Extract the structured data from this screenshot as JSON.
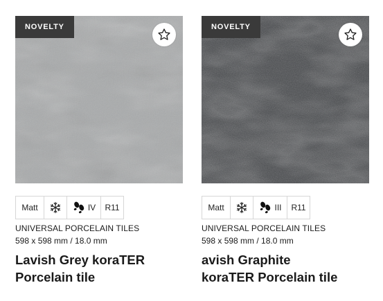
{
  "products": [
    {
      "badge": "NOVELTY",
      "attributes": {
        "finish": "Matt",
        "frost_icon": "snowflake-icon",
        "wear_icon": "footprints-icon",
        "wear": "IV",
        "slip": "R11"
      },
      "category": "UNIVERSAL PORCELAIN TILES",
      "size": "598 x 598 mm / 18.0 mm",
      "title_line1": "Lavish Grey koraTER",
      "title_line2": "Porcelain tile",
      "colors": {
        "base": "#a9abac"
      }
    },
    {
      "badge": "NOVELTY",
      "attributes": {
        "finish": "Matt",
        "frost_icon": "snowflake-icon",
        "wear_icon": "footprints-icon",
        "wear": "III",
        "slip": "R11"
      },
      "category": "UNIVERSAL PORCELAIN TILES",
      "size": "598 x 598 mm / 18.0 mm",
      "title_line1": "avish Graphite",
      "title_line2": "koraTER Porcelain tile",
      "colors": {
        "base": "#4b4d50"
      }
    }
  ]
}
